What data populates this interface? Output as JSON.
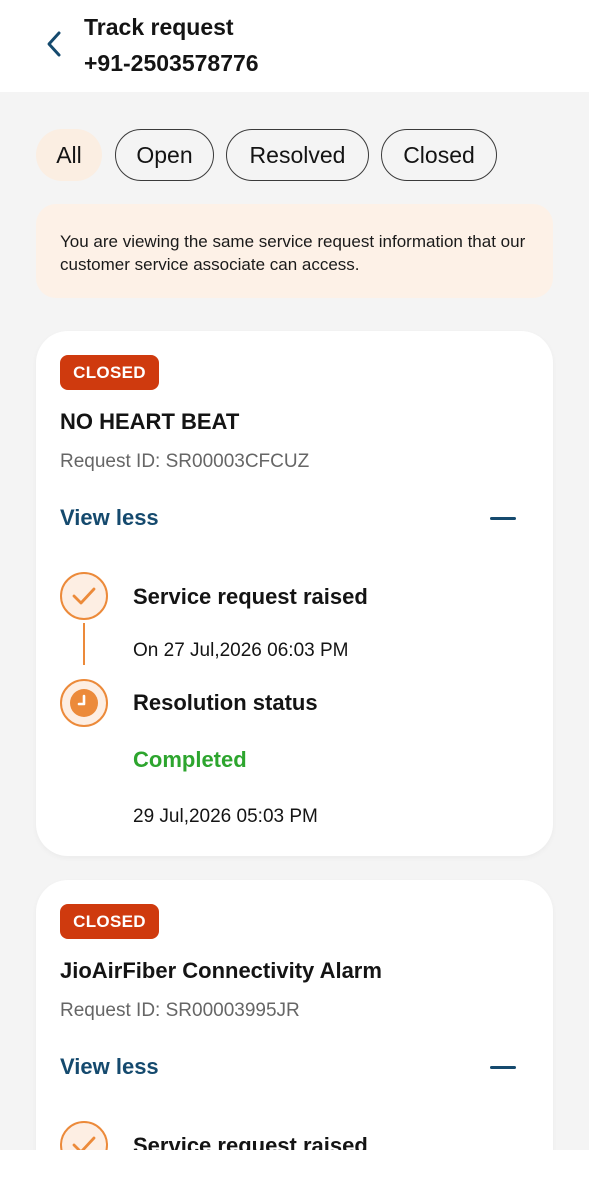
{
  "header": {
    "title": "Track request",
    "phone": "+91-2503578776"
  },
  "filters": [
    {
      "label": "All",
      "active": true
    },
    {
      "label": "Open",
      "active": false
    },
    {
      "label": "Resolved",
      "active": false
    },
    {
      "label": "Closed",
      "active": false
    }
  ],
  "info_banner": {
    "text": "You are viewing the same service request information that our customer service associate can access."
  },
  "requests": [
    {
      "status": "CLOSED",
      "title": "NO HEART BEAT",
      "request_id": "Request ID: SR00003CFCUZ",
      "toggle_label": "View less",
      "timeline": {
        "raised_label": "Service request raised",
        "raised_date": "On 27 Jul,2026 06:03 PM",
        "resolution_label": "Resolution status",
        "resolution_value": "Completed",
        "resolution_date": "29 Jul,2026 05:03 PM"
      }
    },
    {
      "status": "CLOSED",
      "title": "JioAirFiber Connectivity Alarm",
      "request_id": "Request ID: SR00003995JR",
      "toggle_label": "View less",
      "timeline": {
        "raised_label": "Service request raised"
      }
    }
  ],
  "colors": {
    "accent_orange": "#ec8a3a",
    "badge_red": "#cf3a0e",
    "link_blue": "#154a6e",
    "success_green": "#2da52e"
  }
}
